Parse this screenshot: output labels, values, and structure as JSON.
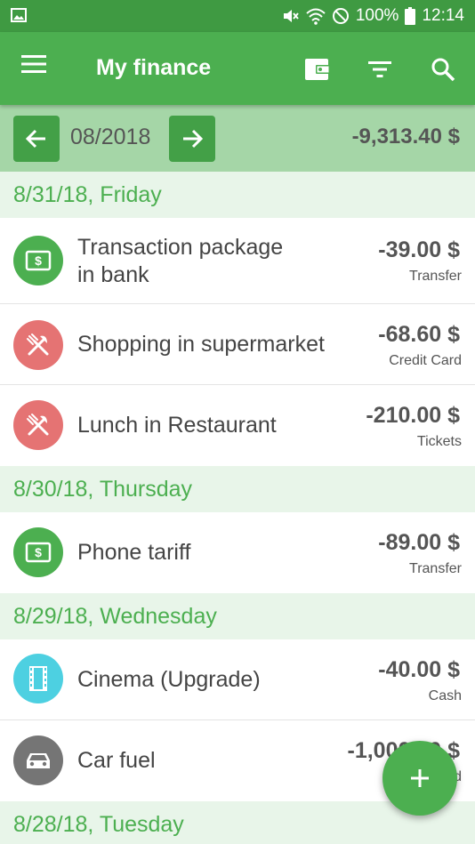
{
  "status_bar": {
    "battery": "100%",
    "time": "12:14",
    "icons": [
      "image-icon",
      "mute-icon",
      "wifi-icon",
      "dnd-icon",
      "battery-icon"
    ]
  },
  "app_bar": {
    "title": "My finance",
    "icons": [
      "menu-icon",
      "wallet-icon",
      "filter-icon",
      "search-icon"
    ]
  },
  "month_bar": {
    "month": "08/2018",
    "total": "-9,313.40 $"
  },
  "colors": {
    "primary": "#4caf50",
    "status_bar": "#3f9a42",
    "month_bar": "#a5d6a7",
    "date_header_bg": "#e8f5e9",
    "transfer_icon_bg": "#4caf50",
    "food_icon_bg": "#e57373",
    "cinema_icon_bg": "#4dd0e1",
    "car_icon_bg": "#757575"
  },
  "groups": [
    {
      "date": "8/31/18, Friday",
      "transactions": [
        {
          "name": "Transaction package in bank",
          "name_line1": "Transaction package",
          "name_line2": "in bank",
          "amount": "-39.00 $",
          "account": "Transfer",
          "icon": "money-icon"
        },
        {
          "name": "Shopping in supermarket",
          "amount": "-68.60 $",
          "account": "Credit Card",
          "icon": "fork-knife-icon"
        },
        {
          "name": "Lunch in Restaurant",
          "amount": "-210.00 $",
          "account": "Tickets",
          "icon": "fork-knife-icon"
        }
      ]
    },
    {
      "date": "8/30/18, Thursday",
      "transactions": [
        {
          "name": "Phone tariff",
          "amount": "-89.00 $",
          "account": "Transfer",
          "icon": "money-icon"
        }
      ]
    },
    {
      "date": "8/29/18, Wednesday",
      "transactions": [
        {
          "name": "Cinema (Upgrade)",
          "amount": "-40.00 $",
          "account": "Cash",
          "icon": "film-icon"
        },
        {
          "name": "Car fuel",
          "amount": "-1,000.00 $",
          "account": "Card",
          "icon": "car-icon"
        }
      ]
    },
    {
      "date": "8/28/18, Tuesday",
      "transactions": []
    }
  ],
  "fab": {
    "icon": "plus-icon"
  }
}
